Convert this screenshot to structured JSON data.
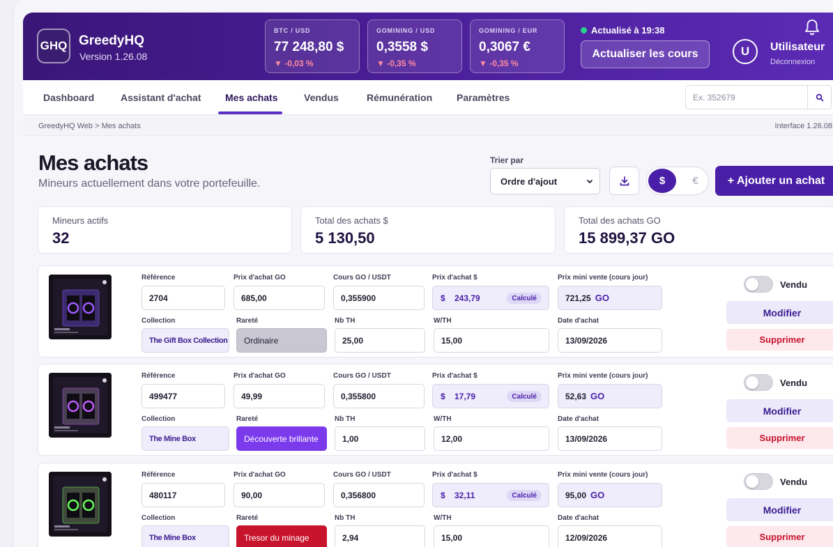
{
  "app": {
    "logo_text": "GHQ",
    "name": "GreedyHQ",
    "version": "Version 1.26.08"
  },
  "tickers": [
    {
      "label": "BTC / USD",
      "value": "77 248,80 $",
      "change": "▼ -0,03 %"
    },
    {
      "label": "GOMINING / USD",
      "value": "0,3558 $",
      "change": "▼ -0,35 %"
    },
    {
      "label": "GOMINING / EUR",
      "value": "0,3067 €",
      "change": "▼ -0,35 %"
    }
  ],
  "status": {
    "text": "Actualisé à 19:38",
    "color": "#2bd38a"
  },
  "refresh_label": "Actualiser les cours",
  "user": {
    "initial": "U",
    "name": "Utilisateur",
    "logout": "Déconnexion"
  },
  "nav": {
    "tabs": [
      "Dashboard",
      "Assistant d'achat",
      "Mes achats",
      "Vendus",
      "Rémunération",
      "Paramètres"
    ],
    "active": "Mes achats"
  },
  "search": {
    "placeholder": "Ex. 352679",
    "value": ""
  },
  "breadcrumb": "GreedyHQ Web > Mes achats",
  "interface_version": "Interface 1.26.08",
  "page": {
    "title": "Mes achats",
    "subtitle": "Mineurs actuellement dans votre portefeuille."
  },
  "sort": {
    "label": "Trier par",
    "value": "Ordre d'ajout"
  },
  "currency": {
    "usd": "$",
    "eur": "€",
    "selected": "$"
  },
  "add_label": "+ Ajouter un achat",
  "stats": [
    {
      "label": "Mineurs actifs",
      "value": "32"
    },
    {
      "label": "Total des achats $",
      "value": "5 130,50"
    },
    {
      "label": "Total des achats GO",
      "value": "15 899,37 GO"
    }
  ],
  "field_labels": {
    "reference": "Référence",
    "price_go": "Prix d'achat GO",
    "rate": "Cours GO / USDT",
    "price_usd": "Prix d'achat $",
    "min_sale": "Prix mini vente (cours jour)",
    "collection": "Collection",
    "rarity": "Rareté",
    "th": "Nb TH",
    "wth": "W/TH",
    "date": "Date d'achat"
  },
  "labels": {
    "usd_symbol": "$",
    "computed": "Calculé",
    "go": "GO",
    "sold": "Vendu",
    "edit": "Modifier",
    "delete": "Supprimer"
  },
  "purchases": [
    {
      "reference": "2704",
      "price_go": "685,00",
      "rate": "0,355900",
      "price_usd": "243,79",
      "min_sale": "721,25",
      "collection": "The Gift Box Collection",
      "rarity": "Ordinaire",
      "rarity_color": "#c9c7d2",
      "th": "25,00",
      "wth": "15,00",
      "date": "13/09/2026",
      "sold": false
    },
    {
      "reference": "499477",
      "price_go": "49,99",
      "rate": "0,355800",
      "price_usd": "17,79",
      "min_sale": "52,63",
      "collection": "The Mine Box",
      "rarity": "Découverte brillante",
      "rarity_color": "#7c3aed",
      "th": "1,00",
      "wth": "12,00",
      "date": "13/09/2026",
      "sold": false
    },
    {
      "reference": "480117",
      "price_go": "90,00",
      "rate": "0,356800",
      "price_usd": "32,11",
      "min_sale": "95,00",
      "collection": "The Mine Box",
      "rarity": "Tresor du minage",
      "rarity_color": "#c8132d",
      "th": "2,94",
      "wth": "15,00",
      "date": "12/09/2026",
      "sold": false
    }
  ],
  "colors": {
    "brand": "#4a1fa8",
    "header_start": "#3a1678",
    "header_end": "#5b2bb5",
    "negative": "#ff8aa0",
    "danger": "#c8132d"
  }
}
